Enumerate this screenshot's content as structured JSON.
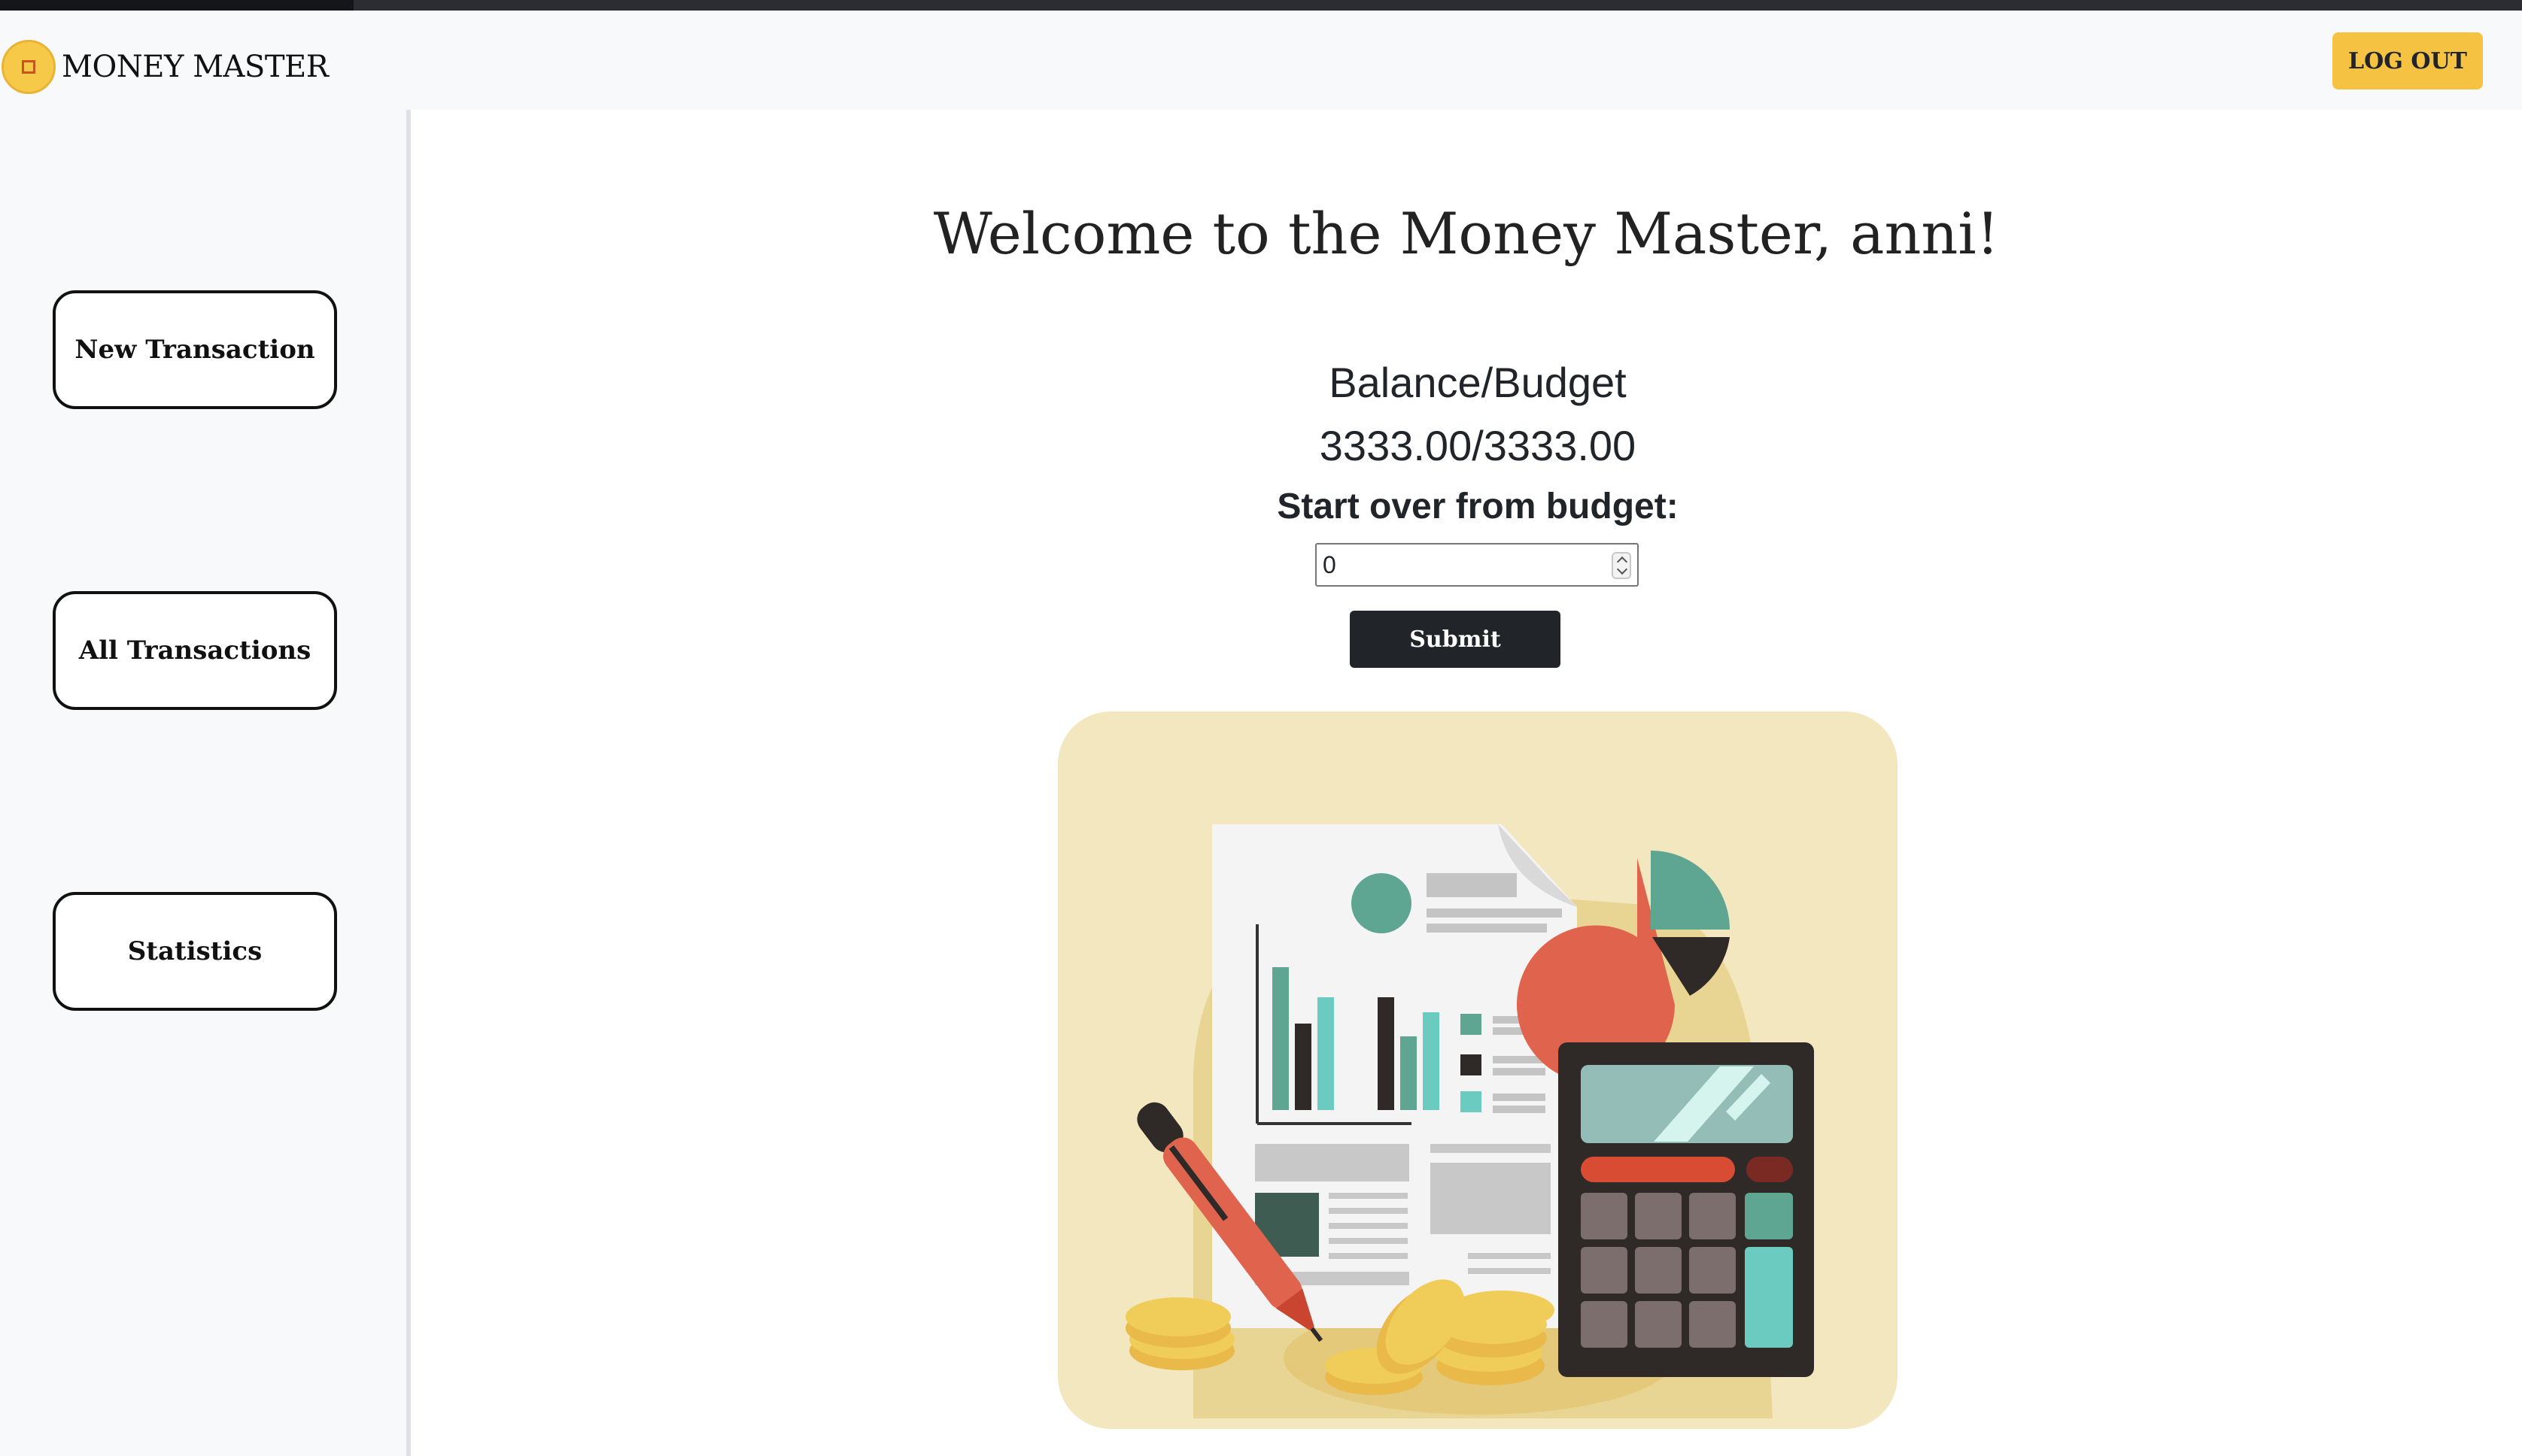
{
  "app": {
    "brand": "MONEY MASTER",
    "logout_label": "LOG OUT",
    "accent_color": "#f5c242"
  },
  "sidebar": {
    "items": [
      {
        "label": "New Transaction"
      },
      {
        "label": "All Transactions"
      },
      {
        "label": "Statistics"
      }
    ]
  },
  "main": {
    "welcome": "Welcome to the Money Master, anni!",
    "balance_label": "Balance/Budget",
    "balance_value": "3333.00/3333.00",
    "reset_label": "Start over from budget:",
    "budget_input_value": "0",
    "submit_label": "Submit"
  },
  "icons": [
    "coin-logo-icon",
    "number-stepper-icon",
    "finance-illustration"
  ]
}
